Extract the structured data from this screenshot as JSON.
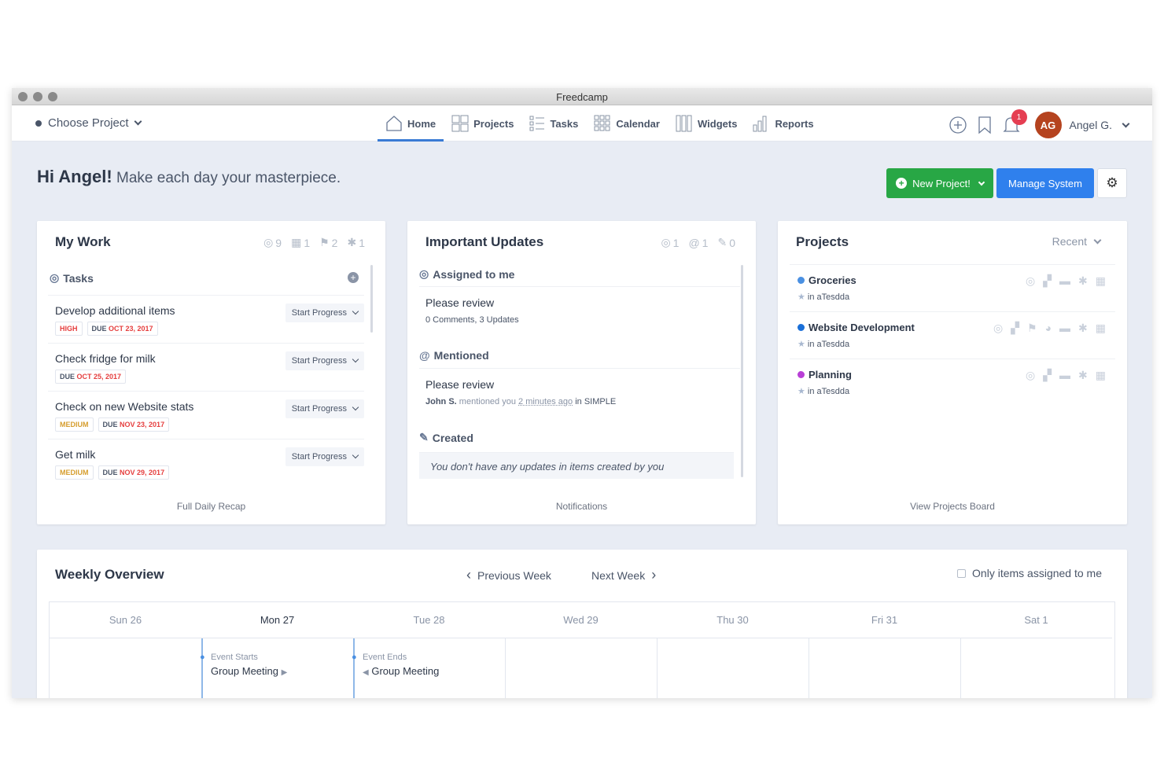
{
  "window": {
    "title": "Freedcamp"
  },
  "topnav": {
    "project_selector": "Choose Project",
    "items": [
      {
        "label": "Home",
        "icon": "home-icon"
      },
      {
        "label": "Projects",
        "icon": "projects-icon"
      },
      {
        "label": "Tasks",
        "icon": "tasks-icon"
      },
      {
        "label": "Calendar",
        "icon": "calendar-icon"
      },
      {
        "label": "Widgets",
        "icon": "widgets-icon"
      },
      {
        "label": "Reports",
        "icon": "reports-icon"
      }
    ],
    "notification_count": "1",
    "avatar_initials": "AG",
    "username": "Angel G."
  },
  "header": {
    "greeting_name": "Hi Angel!",
    "greeting_text": "Make each day your masterpiece.",
    "new_project_label": "New Project!",
    "manage_label": "Manage System"
  },
  "my_work": {
    "title": "My Work",
    "counts": [
      "9",
      "1",
      "2",
      "1"
    ],
    "section": "Tasks",
    "tasks": [
      {
        "name": "Develop additional items",
        "priority": "HIGH",
        "due_label": "DUE",
        "due": "OCT 23, 2017",
        "action": "Start Progress"
      },
      {
        "name": "Check fridge for milk",
        "priority": "",
        "due_label": "DUE",
        "due": "OCT 25, 2017",
        "action": "Start Progress"
      },
      {
        "name": "Check on new Website stats",
        "priority": "MEDIUM",
        "due_label": "DUE",
        "due": "NOV 23, 2017",
        "action": "Start Progress"
      },
      {
        "name": "Get milk",
        "priority": "MEDIUM",
        "due_label": "DUE",
        "due": "NOV 29, 2017",
        "action": "Start Progress"
      }
    ],
    "footer": "Full Daily Recap"
  },
  "updates": {
    "title": "Important Updates",
    "counts": [
      "1",
      "1",
      "0"
    ],
    "assigned_head": "Assigned to me",
    "assigned_item_title": "Please review",
    "assigned_item_sub": "0 Comments, 3 Updates",
    "mentioned_head": "Mentioned",
    "mentioned_item_title": "Please review",
    "mentioned_user": "John S.",
    "mentioned_text": "mentioned you",
    "mentioned_time": "2 minutes ago",
    "mentioned_in": "in",
    "mentioned_project": "SIMPLE",
    "created_head": "Created",
    "created_empty": "You don't have any updates in items created by you",
    "footer": "Notifications"
  },
  "projects": {
    "title": "Projects",
    "sort": "Recent",
    "items": [
      {
        "name": "Groceries",
        "color": "#4a90e2",
        "sub": "in aTesdda"
      },
      {
        "name": "Website Development",
        "color": "#1a6fd8",
        "sub": "in aTesdda"
      },
      {
        "name": "Planning",
        "color": "#b83fd6",
        "sub": "in aTesdda"
      }
    ],
    "footer": "View Projects Board"
  },
  "weekly": {
    "title": "Weekly Overview",
    "prev": "Previous Week",
    "next": "Next Week",
    "filter": "Only items assigned to me",
    "days": [
      "Sun 26",
      "Mon 27",
      "Tue 28",
      "Wed 29",
      "Thu 30",
      "Fri 31",
      "Sat 1"
    ],
    "events": [
      {
        "kind": "Event Starts",
        "name": "Group Meeting"
      },
      {
        "kind": "Event Ends",
        "name": "Group Meeting"
      }
    ]
  }
}
